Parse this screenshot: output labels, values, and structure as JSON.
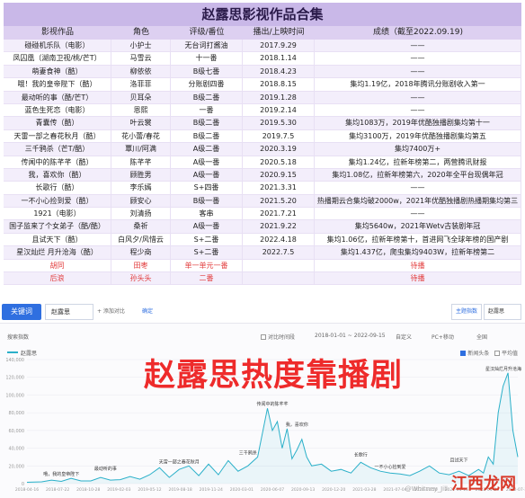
{
  "title": "赵露思影视作品合集",
  "headers": [
    "影视作品",
    "角色",
    "评级/番位",
    "播出/上映时间",
    "成绩（截至2022.09.19)"
  ],
  "rows": [
    [
      "碰碰机乐队（电影）",
      "小护士",
      "无台词打酱油",
      "2017.9.29",
      "——"
    ],
    [
      "凤囚凰（湖南卫视/桃/芒T）",
      "马雪云",
      "十一番",
      "2018.1.14",
      "——"
    ],
    [
      "萌妻食神（酷）",
      "柳依依",
      "B级七番",
      "2018.4.23",
      "——"
    ],
    [
      "哦！我的皇帝陛下（酷）",
      "洛菲菲",
      "分账剧四番",
      "2018.8.15",
      "集均1.19亿，2018年腾讯分账剧收入第一"
    ],
    [
      "最动听的事（酷/芒T）",
      "贝耳朵",
      "B级二番",
      "2019.1.28",
      "——"
    ],
    [
      "蓝色生死恋（电影）",
      "恩熙",
      "一番",
      "2019.2.14",
      "——"
    ],
    [
      "青囊传（酷）",
      "叶云裳",
      "B级二番",
      "2019.5.30",
      "集均1083万，2019年优酷独播剧集均第十一"
    ],
    [
      "天雷一部之春花秋月（酷）",
      "花小蕾/春花",
      "B级二番",
      "2019.7.5",
      "集均3100万，2019年优酷独播剧集均第五"
    ],
    [
      "三千鸦杀（芒T/酷）",
      "覃川/阿满",
      "A级二番",
      "2020.3.19",
      "集均7400万+"
    ],
    [
      "传闻中的陈芊芊（酷）",
      "陈芊芊",
      "A级一番",
      "2020.5.18",
      "集均1.24亿，拉新年榜第二，两营腾讯财报"
    ],
    [
      "我，喜欢你（酷）",
      "顾胜男",
      "A级一番",
      "2020.9.15",
      "集均1.08亿，拉新年榜第六，2020年全平台现偶年冠"
    ],
    [
      "长歌行（酷）",
      "李乐嫣",
      "S+四番",
      "2021.3.31",
      "——"
    ],
    [
      "一不小心捡到爱（酷）",
      "顾安心",
      "B级一番",
      "2021.5.20",
      "热播期云合集均破2000w，2021年优酷独播剧热播期集均第三"
    ],
    [
      "1921（电影）",
      "刘清扬",
      "客串",
      "2021.7.21",
      "——"
    ],
    [
      "国子监来了个女弟子（酷/酷）",
      "桑祈",
      "A级一番",
      "2021.9.22",
      "集均5640w，2021年Wetv古装剧年冠"
    ],
    [
      "且试天下（酷）",
      "白风夕/风惜云",
      "S+二番",
      "2022.4.18",
      "集均1.06亿，拉新年榜第十，首进网飞全球年榜的国产剧"
    ],
    [
      "星汉灿烂 月升沧海（酷）",
      "程少商",
      "S+二番",
      "2022.7.5",
      "集均1.437亿，爬虫集均9403W，拉新年榜第二"
    ],
    [
      "胡同",
      "田枣",
      "单一单元一番",
      "",
      "待播"
    ],
    [
      "后浪",
      "孙头头",
      "二番",
      "",
      "待播"
    ]
  ],
  "red_rows": [
    17,
    18
  ],
  "toolbar": {
    "keyword_tab": "关键词",
    "keyword_value": "赵露思",
    "add_compare": "+ 添加对比",
    "confirm": "确定",
    "right_tab": "主题指数",
    "right_value": "赵露思"
  },
  "filters": {
    "section": "搜索指数",
    "compare_label": "对比时间段",
    "date_range": "2018-01-01 ~ 2022-09-15",
    "custom": "自定义",
    "device": "PC+移动",
    "region": "全国",
    "huati_label": "新闻头条",
    "avg_label": "平均值"
  },
  "legend": "赵露思",
  "caption": "赵露思热度靠播剧",
  "watermark_text": "江西龙网",
  "watermark_sub": "@Whitney_Jill",
  "chart_data": {
    "type": "line",
    "ylim": [
      0,
      140000
    ],
    "yticks": [
      0,
      20000,
      40000,
      60000,
      80000,
      100000,
      120000,
      140000
    ],
    "ytick_labels": [
      "0",
      "20,000",
      "40,000",
      "60,000",
      "80,000",
      "100,000",
      "120,000",
      "140,000"
    ],
    "xtick_labels": [
      "2018-04-16",
      "2018-07-22",
      "2018-10-28",
      "2019-02-03",
      "2019-05-12",
      "2019-08-18",
      "2019-11-24",
      "2020-03-01",
      "2020-06-07",
      "2020-09-13",
      "2020-12-20",
      "2021-03-28",
      "2021-07-04",
      "2021-10-10",
      "2022-01-16",
      "2022-04-24",
      "2022-07-31"
    ],
    "series": [
      {
        "name": "赵露思",
        "x": [
          0,
          0.03,
          0.05,
          0.07,
          0.09,
          0.11,
          0.13,
          0.15,
          0.17,
          0.19,
          0.21,
          0.23,
          0.25,
          0.27,
          0.29,
          0.31,
          0.33,
          0.35,
          0.37,
          0.39,
          0.41,
          0.43,
          0.45,
          0.47,
          0.49,
          0.5,
          0.51,
          0.52,
          0.53,
          0.54,
          0.55,
          0.56,
          0.57,
          0.58,
          0.6,
          0.62,
          0.64,
          0.66,
          0.68,
          0.7,
          0.72,
          0.74,
          0.76,
          0.78,
          0.8,
          0.82,
          0.84,
          0.86,
          0.88,
          0.9,
          0.92,
          0.93,
          0.94,
          0.95,
          0.96,
          0.97,
          0.98,
          0.99,
          1.0
        ],
        "values": [
          1500,
          2000,
          4000,
          2500,
          6000,
          3000,
          3000,
          7000,
          4000,
          4500,
          8000,
          5000,
          10000,
          18000,
          7000,
          16000,
          20000,
          9000,
          22000,
          10000,
          26000,
          14000,
          20000,
          30000,
          85000,
          60000,
          70000,
          40000,
          62000,
          28000,
          38000,
          50000,
          30000,
          20000,
          22000,
          14000,
          16000,
          12000,
          24000,
          18000,
          14000,
          12000,
          11000,
          9000,
          14000,
          20000,
          12000,
          10000,
          14000,
          9000,
          16000,
          12000,
          30000,
          22000,
          80000,
          110000,
          125000,
          60000,
          30000
        ]
      }
    ],
    "annotations": [
      {
        "label": "哦，我的皇帝陛下",
        "x": 0.07,
        "y": 6000
      },
      {
        "label": "最动听的事",
        "x": 0.16,
        "y": 12000
      },
      {
        "label": "天雷一部之春花秋月",
        "x": 0.31,
        "y": 20000
      },
      {
        "label": "三千鸦杀",
        "x": 0.45,
        "y": 30000
      },
      {
        "label": "传闻中的陈芊芊",
        "x": 0.5,
        "y": 85000
      },
      {
        "label": "我，喜欢你",
        "x": 0.55,
        "y": 62000
      },
      {
        "label": "长歌行",
        "x": 0.68,
        "y": 28000
      },
      {
        "label": "一不小心捡到爱",
        "x": 0.74,
        "y": 14000
      },
      {
        "label": "且试天下",
        "x": 0.88,
        "y": 22000
      },
      {
        "label": "星汉灿烂月升沧海",
        "x": 0.98,
        "y": 125000
      }
    ]
  }
}
